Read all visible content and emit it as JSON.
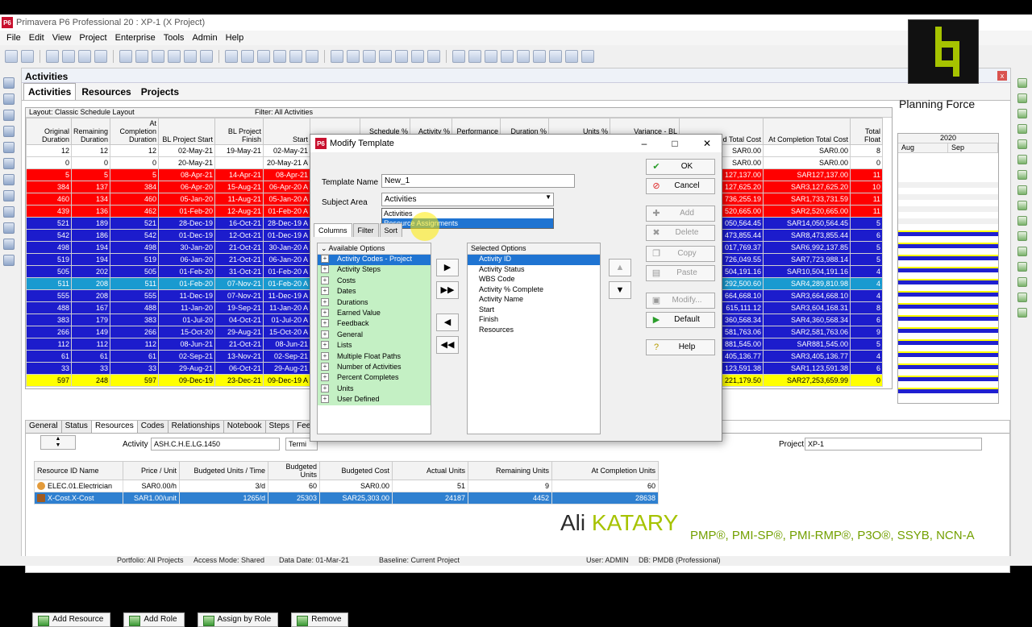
{
  "window": {
    "title": "Primavera P6 Professional 20 : XP-1 (X Project)",
    "logo": "P6"
  },
  "menu": [
    "File",
    "Edit",
    "View",
    "Project",
    "Enterprise",
    "Tools",
    "Admin",
    "Help"
  ],
  "panel": {
    "title": "Activities",
    "tabs": [
      "Activities",
      "Resources",
      "Projects"
    ],
    "close": "x"
  },
  "layout": {
    "layout_label": "Layout: Classic Schedule Layout",
    "filter_label": "Filter: All Activities"
  },
  "grid": {
    "columns": [
      "Original Duration",
      "Remaining Duration",
      "At Completion Duration",
      "BL Project Start",
      "BL Project Finish",
      "Start",
      "Finish",
      "Schedule % Complete",
      "Activity % Complete",
      "Performance % Complete",
      "Duration % Complete",
      "Units % Complete",
      "Variance - BL Project Finish Date",
      "Budgeted Total Cost",
      "At Completion Total Cost",
      "Total Float"
    ],
    "rows": [
      {
        "style": "white",
        "cells": [
          "12",
          "12",
          "12",
          "02-May-21",
          "19-May-21",
          "02-May-21",
          "",
          "",
          "",
          "",
          "",
          "",
          "",
          "SAR0.00",
          "SAR0.00",
          "8"
        ]
      },
      {
        "style": "white",
        "cells": [
          "0",
          "0",
          "0",
          "20-May-21",
          "",
          "20-May-21 A",
          "",
          "",
          "",
          "",
          "",
          "",
          "",
          "SAR0.00",
          "SAR0.00",
          "0"
        ]
      },
      {
        "style": "red",
        "cells": [
          "5",
          "5",
          "5",
          "08-Apr-21",
          "14-Apr-21",
          "08-Apr-21",
          "",
          "",
          "",
          "",
          "",
          "",
          "",
          "127,137.00",
          "SAR127,137.00",
          "11"
        ]
      },
      {
        "style": "red",
        "cells": [
          "384",
          "137",
          "384",
          "06-Apr-20",
          "15-Aug-21",
          "06-Apr-20 A",
          "",
          "",
          "",
          "",
          "",
          "",
          "",
          "127,625.20",
          "SAR3,127,625.20",
          "10"
        ]
      },
      {
        "style": "red",
        "cells": [
          "460",
          "134",
          "460",
          "05-Jan-20",
          "11-Aug-21",
          "05-Jan-20 A",
          "",
          "",
          "",
          "",
          "",
          "",
          "",
          "736,255.19",
          "SAR1,733,731.59",
          "11"
        ]
      },
      {
        "style": "red",
        "cells": [
          "439",
          "136",
          "462",
          "01-Feb-20",
          "12-Aug-21",
          "01-Feb-20 A",
          "",
          "",
          "",
          "",
          "",
          "",
          "",
          "520,665.00",
          "SAR2,520,665.00",
          "11"
        ]
      },
      {
        "style": "blue",
        "cells": [
          "521",
          "189",
          "521",
          "28-Dec-19",
          "16-Oct-21",
          "28-Dec-19 A",
          "",
          "",
          "",
          "",
          "",
          "",
          "",
          "050,564.45",
          "SAR14,050,564.45",
          "5"
        ]
      },
      {
        "style": "blue",
        "cells": [
          "542",
          "186",
          "542",
          "01-Dec-19",
          "12-Oct-21",
          "01-Dec-19 A",
          "",
          "",
          "",
          "",
          "",
          "",
          "",
          "473,855.44",
          "SAR8,473,855.44",
          "6"
        ]
      },
      {
        "style": "blue",
        "cells": [
          "498",
          "194",
          "498",
          "30-Jan-20",
          "21-Oct-21",
          "30-Jan-20 A",
          "",
          "",
          "",
          "",
          "",
          "",
          "",
          "017,769.37",
          "SAR6,992,137.85",
          "5"
        ]
      },
      {
        "style": "blue",
        "cells": [
          "519",
          "194",
          "519",
          "06-Jan-20",
          "21-Oct-21",
          "06-Jan-20 A",
          "",
          "",
          "",
          "",
          "",
          "",
          "",
          "726,049.55",
          "SAR7,723,988.14",
          "5"
        ]
      },
      {
        "style": "blue",
        "cells": [
          "505",
          "202",
          "505",
          "01-Feb-20",
          "31-Oct-21",
          "01-Feb-20 A",
          "",
          "",
          "",
          "",
          "",
          "",
          "",
          "504,191.16",
          "SAR10,504,191.16",
          "4"
        ]
      },
      {
        "style": "cyan",
        "cells": [
          "511",
          "208",
          "511",
          "01-Feb-20",
          "07-Nov-21",
          "01-Feb-20 A",
          "",
          "",
          "",
          "",
          "",
          "",
          "",
          "292,500.60",
          "SAR4,289,810.98",
          "4"
        ]
      },
      {
        "style": "blue",
        "cells": [
          "555",
          "208",
          "555",
          "11-Dec-19",
          "07-Nov-21",
          "11-Dec-19 A",
          "",
          "",
          "",
          "",
          "",
          "",
          "",
          "664,668.10",
          "SAR3,664,668.10",
          "4"
        ]
      },
      {
        "style": "blue",
        "cells": [
          "488",
          "167",
          "488",
          "11-Jan-20",
          "19-Sep-21",
          "11-Jan-20 A",
          "",
          "",
          "",
          "",
          "",
          "",
          "",
          "615,111.12",
          "SAR3,604,168.31",
          "8"
        ]
      },
      {
        "style": "blue",
        "cells": [
          "383",
          "179",
          "383",
          "01-Jul-20",
          "04-Oct-21",
          "01-Jul-20 A",
          "",
          "",
          "",
          "",
          "",
          "",
          "",
          "360,568.34",
          "SAR4,360,568.34",
          "6"
        ]
      },
      {
        "style": "blue",
        "cells": [
          "266",
          "149",
          "266",
          "15-Oct-20",
          "29-Aug-21",
          "15-Oct-20 A",
          "",
          "",
          "",
          "",
          "",
          "",
          "",
          "581,763.06",
          "SAR2,581,763.06",
          "9"
        ]
      },
      {
        "style": "blue",
        "cells": [
          "112",
          "112",
          "112",
          "08-Jun-21",
          "21-Oct-21",
          "08-Jun-21",
          "",
          "",
          "",
          "",
          "",
          "",
          "",
          "881,545.00",
          "SAR881,545.00",
          "5"
        ]
      },
      {
        "style": "blue",
        "cells": [
          "61",
          "61",
          "61",
          "02-Sep-21",
          "13-Nov-21",
          "02-Sep-21",
          "",
          "",
          "",
          "",
          "",
          "",
          "",
          "405,136.77",
          "SAR3,405,136.77",
          "4"
        ]
      },
      {
        "style": "blue",
        "cells": [
          "33",
          "33",
          "33",
          "29-Aug-21",
          "06-Oct-21",
          "29-Aug-21",
          "",
          "",
          "",
          "",
          "",
          "",
          "",
          "123,591.38",
          "SAR1,123,591.38",
          "6"
        ]
      },
      {
        "style": "yellow",
        "cells": [
          "597",
          "248",
          "597",
          "09-Dec-19",
          "23-Dec-21",
          "09-Dec-19 A",
          "",
          "",
          "",
          "",
          "",
          "",
          "",
          "221,179.50",
          "SAR27,253,659.99",
          "0"
        ]
      }
    ]
  },
  "gantt": {
    "year": "2020",
    "months": [
      "Aug",
      "Sep"
    ]
  },
  "lower": {
    "tabs": [
      "General",
      "Status",
      "Resources",
      "Codes",
      "Relationships",
      "Notebook",
      "Steps",
      "Feedback"
    ],
    "activity_label": "Activity",
    "activity_value": "ASH.C.H.E.LG.1450",
    "activity_name": "Termi",
    "project_label": "Project",
    "project_value": "XP-1",
    "columns": [
      "Resource ID Name",
      "Price / Unit",
      "Budgeted Units / Time",
      "Budgeted Units",
      "Budgeted Cost",
      "Actual Units",
      "Remaining Units",
      "At Completion Units"
    ],
    "rows": [
      {
        "selected": false,
        "cells": [
          "ELEC.01.Electrician",
          "SAR0.00/h",
          "3/d",
          "60",
          "SAR0.00",
          "51",
          "9",
          "60"
        ]
      },
      {
        "selected": true,
        "cells": [
          "X-Cost.X-Cost",
          "SAR1.00/unit",
          "1265/d",
          "25303",
          "SAR25,303.00",
          "24187",
          "4452",
          "28638"
        ]
      }
    ],
    "buttons": [
      "Add Resource",
      "Add Role",
      "Assign by Role",
      "Remove"
    ]
  },
  "status": {
    "portfolio": "Portfolio: All Projects",
    "access": "Access Mode: Shared",
    "data_date": "Data Date: 01-Mar-21",
    "baseline": "Baseline: Current Project",
    "user": "User: ADMIN",
    "db": "DB: PMDB (Professional)"
  },
  "dialog": {
    "title": "Modify Template",
    "template_name_label": "Template Name",
    "template_name_value": "New_1",
    "subject_area_label": "Subject Area",
    "subject_area_value": "Activities",
    "subject_options": [
      "Activities",
      "Resource Assignments"
    ],
    "tabs": [
      "Columns",
      "Filter",
      "Sort"
    ],
    "available_header": "Available Options",
    "available": [
      "Activity Codes - Project",
      "Activity Steps",
      "Costs",
      "Dates",
      "Durations",
      "Earned Value",
      "Feedback",
      "General",
      "Lists",
      "Multiple Float Paths",
      "Number of Activities",
      "Percent Completes",
      "Units",
      "User Defined"
    ],
    "selected_header": "Selected Options",
    "selected": [
      "Activity ID",
      "Activity Status",
      "WBS Code",
      "Activity % Complete",
      "Activity Name",
      "Start",
      "Finish",
      "Resources"
    ],
    "buttons": {
      "ok": "OK",
      "cancel": "Cancel",
      "add": "Add",
      "delete": "Delete",
      "copy": "Copy",
      "paste": "Paste",
      "modify": "Modify...",
      "default": "Default",
      "help": "Help"
    }
  },
  "branding": {
    "logo_text": "Planning Force",
    "author_first": "Ali",
    "author_last": "KATARY",
    "certs": "PMP®, PMI-SP®, PMI-RMP®, P3O®, SSYB, NCN-A"
  }
}
